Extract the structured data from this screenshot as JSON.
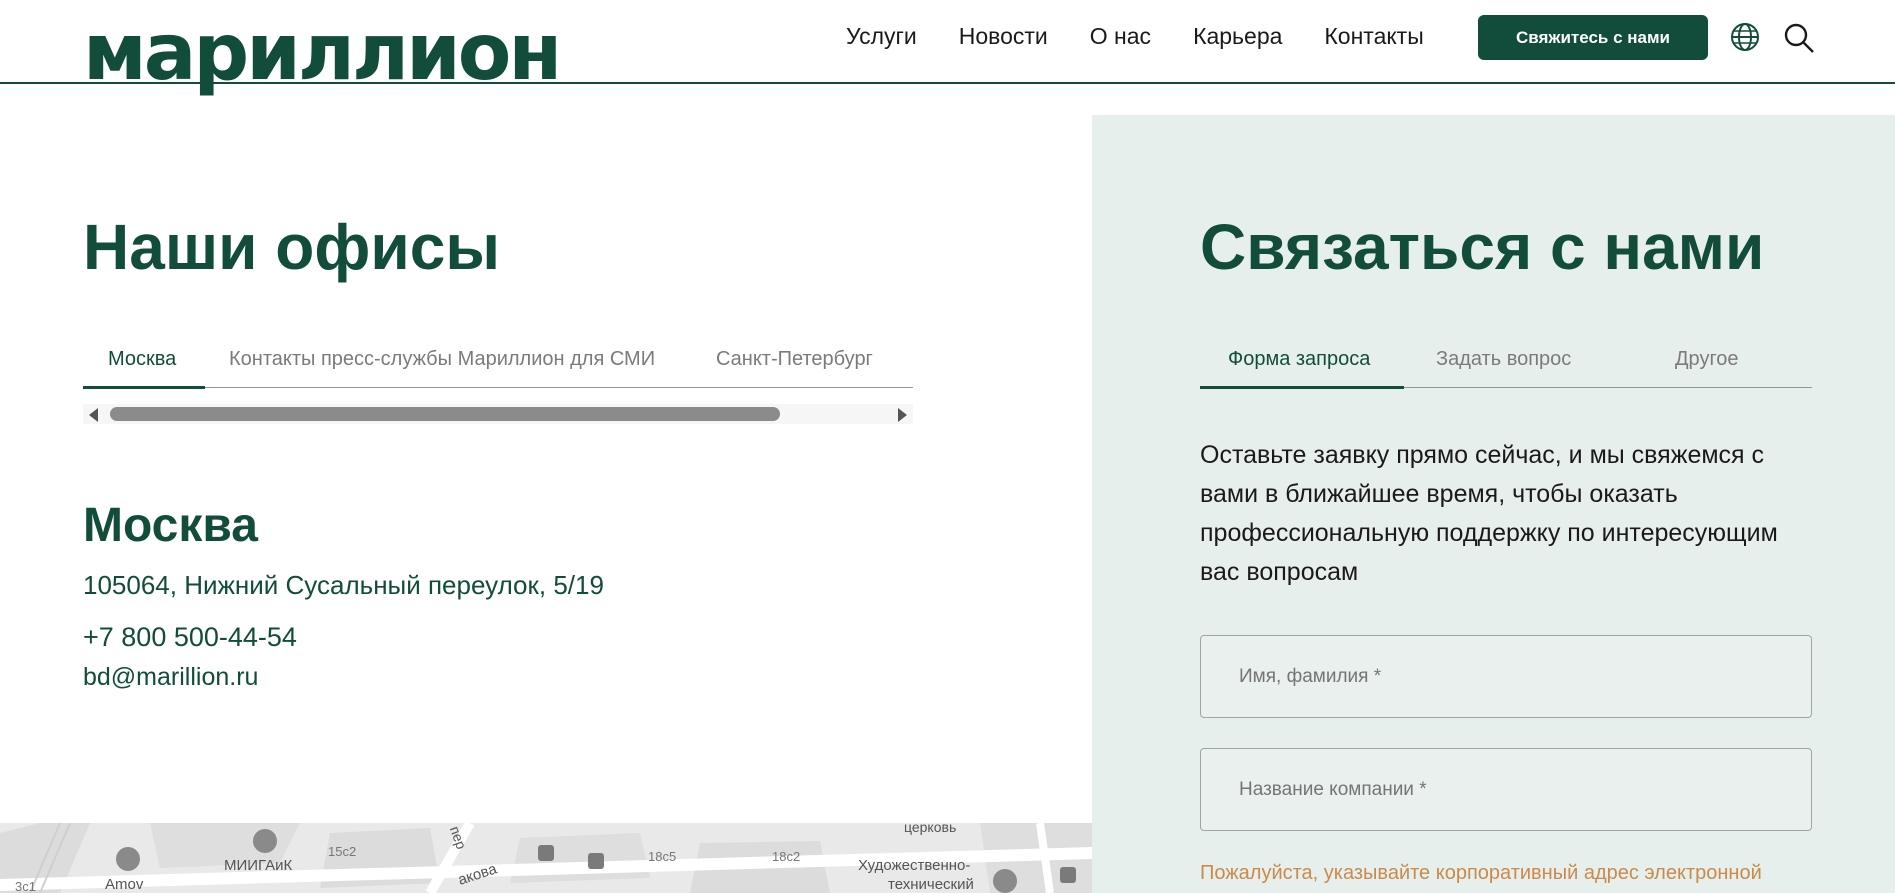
{
  "header": {
    "logo": "мариллион",
    "nav": [
      "Услуги",
      "Новости",
      "О нас",
      "Карьера",
      "Контакты"
    ],
    "cta_label": "Свяжитесь с нами",
    "icons": [
      "globe-icon",
      "search-icon"
    ]
  },
  "offices": {
    "title": "Наши офисы",
    "tabs": [
      "Москва",
      "Контакты пресс-службы Мариллион для СМИ",
      "Санкт-Петербург"
    ],
    "active_tab": "Москва",
    "city": "Москва",
    "address": "105064, Нижний Сусальный переулок, 5/19",
    "phone": "+7 800 500-44-54",
    "email": "bd@marillion.ru"
  },
  "map": {
    "labels": [
      "Amov",
      "МИИГАиК",
      "15с2",
      "18с5",
      "18с2",
      "Художественно-",
      "технический",
      "церковь",
      "пер",
      "акова",
      "3с1"
    ]
  },
  "contact": {
    "title": "Связаться с нами",
    "tabs": [
      "Форма запроса",
      "Задать вопрос",
      "Другое"
    ],
    "active_tab": "Форма запроса",
    "intro": "Оставьте заявку прямо сейчас, и мы свяжемся с вами в ближайшее время, чтобы оказать профессиональную поддержку по интересующим вас вопросам",
    "fields": [
      {
        "placeholder": "Имя, фамилия *"
      },
      {
        "placeholder": "Название компании *"
      }
    ],
    "hint": "Пожалуйста, указывайте корпоративный адрес электронной"
  },
  "colors": {
    "brand": "#114d3a",
    "panel_bg": "#e7efec",
    "hint": "#c98a4a"
  }
}
